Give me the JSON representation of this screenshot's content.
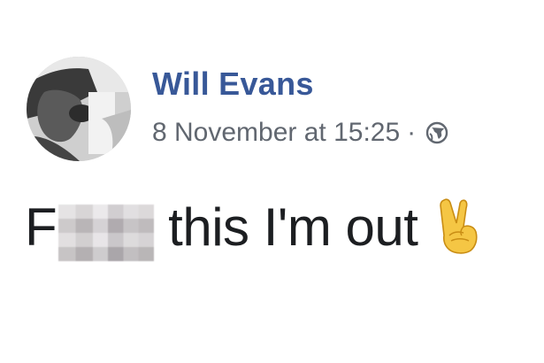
{
  "post": {
    "author": "Will Evans",
    "timestamp": "8 November at 15:25",
    "separator": "·",
    "privacy_icon": "globe-icon",
    "message_prefix": "F",
    "message_rest": "this I'm out",
    "emoji": "victory-hand-emoji",
    "colors": {
      "author": "#385898",
      "meta": "#616770",
      "text": "#1c1e21"
    }
  }
}
